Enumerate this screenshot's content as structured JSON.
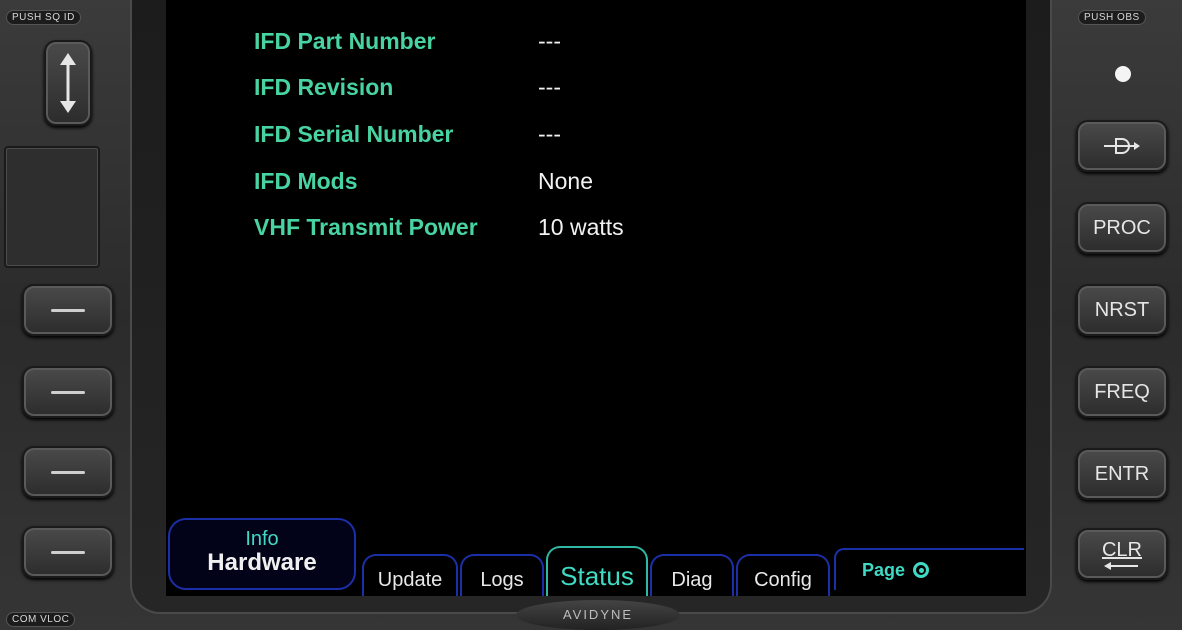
{
  "bezel": {
    "top_left_label": "PUSH SQ ID",
    "top_right_label": "PUSH OBS",
    "bottom_left_label": "COM VLOC",
    "brand": "AVIDYNE"
  },
  "right_buttons": [
    "PROC",
    "NRST",
    "FREQ",
    "ENTR",
    "CLR"
  ],
  "info": [
    {
      "label": "IFD Part Number",
      "value": "---"
    },
    {
      "label": "IFD Revision",
      "value": "---"
    },
    {
      "label": "IFD Serial Number",
      "value": "---"
    },
    {
      "label": "IFD Mods",
      "value": "None"
    },
    {
      "label": "VHF Transmit Power",
      "value": "10 watts"
    }
  ],
  "tabs": {
    "category": "Info",
    "page": "Hardware",
    "items": [
      {
        "label": "Update",
        "active": false
      },
      {
        "label": "Logs",
        "active": false
      },
      {
        "label": "Status",
        "active": true
      },
      {
        "label": "Diag",
        "active": false
      },
      {
        "label": "Config",
        "active": false
      }
    ],
    "page_label": "Page"
  },
  "icons": [
    "double-arrow-icon",
    "direct-to-icon",
    "page-knob-icon"
  ],
  "colors": {
    "accent": "#48d3a2",
    "tab_border": "#1b2fa8",
    "active_tab": "#3fd9c4"
  }
}
